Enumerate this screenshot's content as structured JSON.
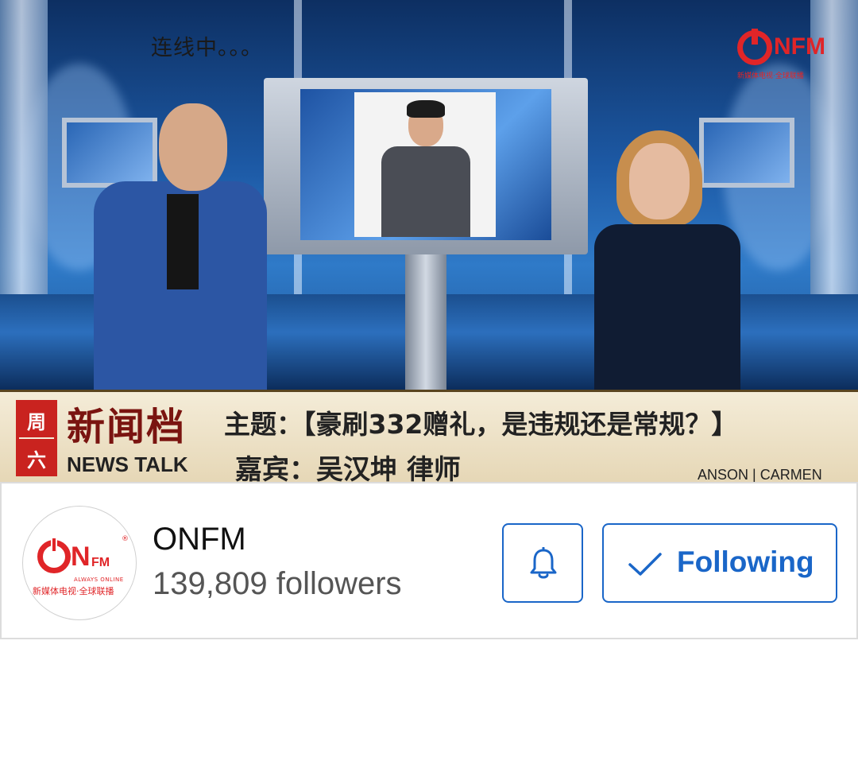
{
  "video": {
    "live_status": "连线中。。。",
    "corner_logo": {
      "brand": "NFM",
      "subtitle": "新媒体电视·全球联播"
    },
    "banner": {
      "day_top": "周",
      "day_bottom": "六",
      "program_cn": "新闻档",
      "program_en": "NEWS TALK",
      "topic": "主题：【豪刷332赠礼，是违规还是常规？】",
      "guest": "嘉宾：吴汉坤 律师",
      "hosts": "ANSON | CARMEN"
    }
  },
  "channel": {
    "avatar": {
      "brand_n": "N",
      "brand_fm": "FM",
      "registered": "®",
      "always_online": "ALWAYS ONLINE",
      "tagline": "新媒体电视·全球联播"
    },
    "name": "ONFM",
    "followers": "139,809 followers",
    "follow_label": "Following",
    "accent_color": "#1a66c8",
    "brand_color": "#e02528"
  }
}
